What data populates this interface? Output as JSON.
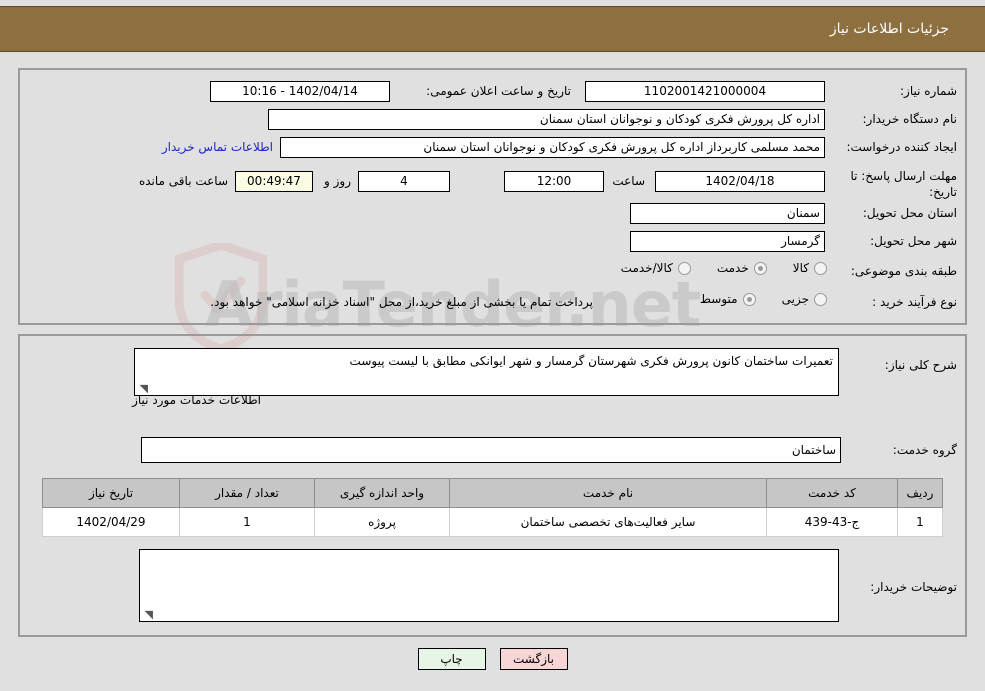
{
  "header": {
    "title": "جزئیات اطلاعات نیاز"
  },
  "colors": {
    "header_brown": "#8d6f40",
    "page_bg": "#e0e0e0",
    "link_blue": "#2222cc",
    "timer_bg": "#fcfbe4",
    "print_btn": "#e6f5e6",
    "back_btn": "#f9d6d6",
    "table_header": "#c6c6c6"
  },
  "form": {
    "need_number_label": "شماره نیاز:",
    "need_number_value": "1102001421000004",
    "announce_label": "تاریخ و ساعت اعلان عمومی:",
    "announce_value": "1402/04/14 - 10:16",
    "buyer_org_label": "نام دستگاه خریدار:",
    "buyer_org_value": "اداره کل پرورش فکری کودکان و نوجوانان استان سمنان",
    "requester_label": "ایجاد کننده درخواست:",
    "requester_value": "محمد مسلمی کاربرداز اداره کل پرورش فکری کودکان و نوجوانان استان سمنان",
    "contact_link": "اطلاعات تماس خریدار",
    "deadline_label": "مهلت ارسال پاسخ: تا تاریخ:",
    "deadline_date": "1402/04/18",
    "hour_label": "ساعت",
    "deadline_time": "12:00",
    "days_value": "4",
    "days_label": "روز و",
    "countdown_value": "00:49:47",
    "remaining_label": "ساعت باقی مانده",
    "province_label": "استان محل تحویل:",
    "province_value": "سمنان",
    "city_label": "شهر محل تحویل:",
    "city_value": "گرمسار",
    "category_label": "طبقه بندی موضوعی:",
    "category_options": [
      {
        "label": "کالا",
        "selected": false
      },
      {
        "label": "خدمت",
        "selected": true
      },
      {
        "label": "کالا/خدمت",
        "selected": false
      }
    ],
    "process_label": "نوع فرآیند خرید :",
    "process_options": [
      {
        "label": "جزیی",
        "selected": false
      },
      {
        "label": "متوسط",
        "selected": true
      }
    ],
    "payment_note": "پرداخت تمام یا بخشی از مبلغ خرید،از محل \"اسناد خزانه اسلامی\" خواهد بود."
  },
  "description": {
    "label": "شرح کلی نیاز:",
    "value": "تعمیرات ساختمان کانون پرورش فکری  شهرستان گرمسار و شهر ایوانکی مطابق با لیست پیوست"
  },
  "services_section": {
    "heading": "اطلاعات خدمات مورد نیاز",
    "group_label": "گروه خدمت:",
    "group_value": "ساختمان"
  },
  "table": {
    "columns": [
      "ردیف",
      "کد خدمت",
      "نام خدمت",
      "واحد اندازه گیری",
      "تعداد / مقدار",
      "تاریخ نیاز"
    ],
    "rows": [
      {
        "index": "1",
        "code": "ج-43-439",
        "name": "سایر فعالیت‌های تخصصی ساختمان",
        "unit": "پروژه",
        "qty": "1",
        "date": "1402/04/29"
      }
    ]
  },
  "buyer_notes": {
    "label": "توضیحات خریدار:",
    "value": ""
  },
  "buttons": {
    "print": "چاپ",
    "back": "بازگشت"
  },
  "watermark": {
    "text": "AriaTender.net"
  }
}
